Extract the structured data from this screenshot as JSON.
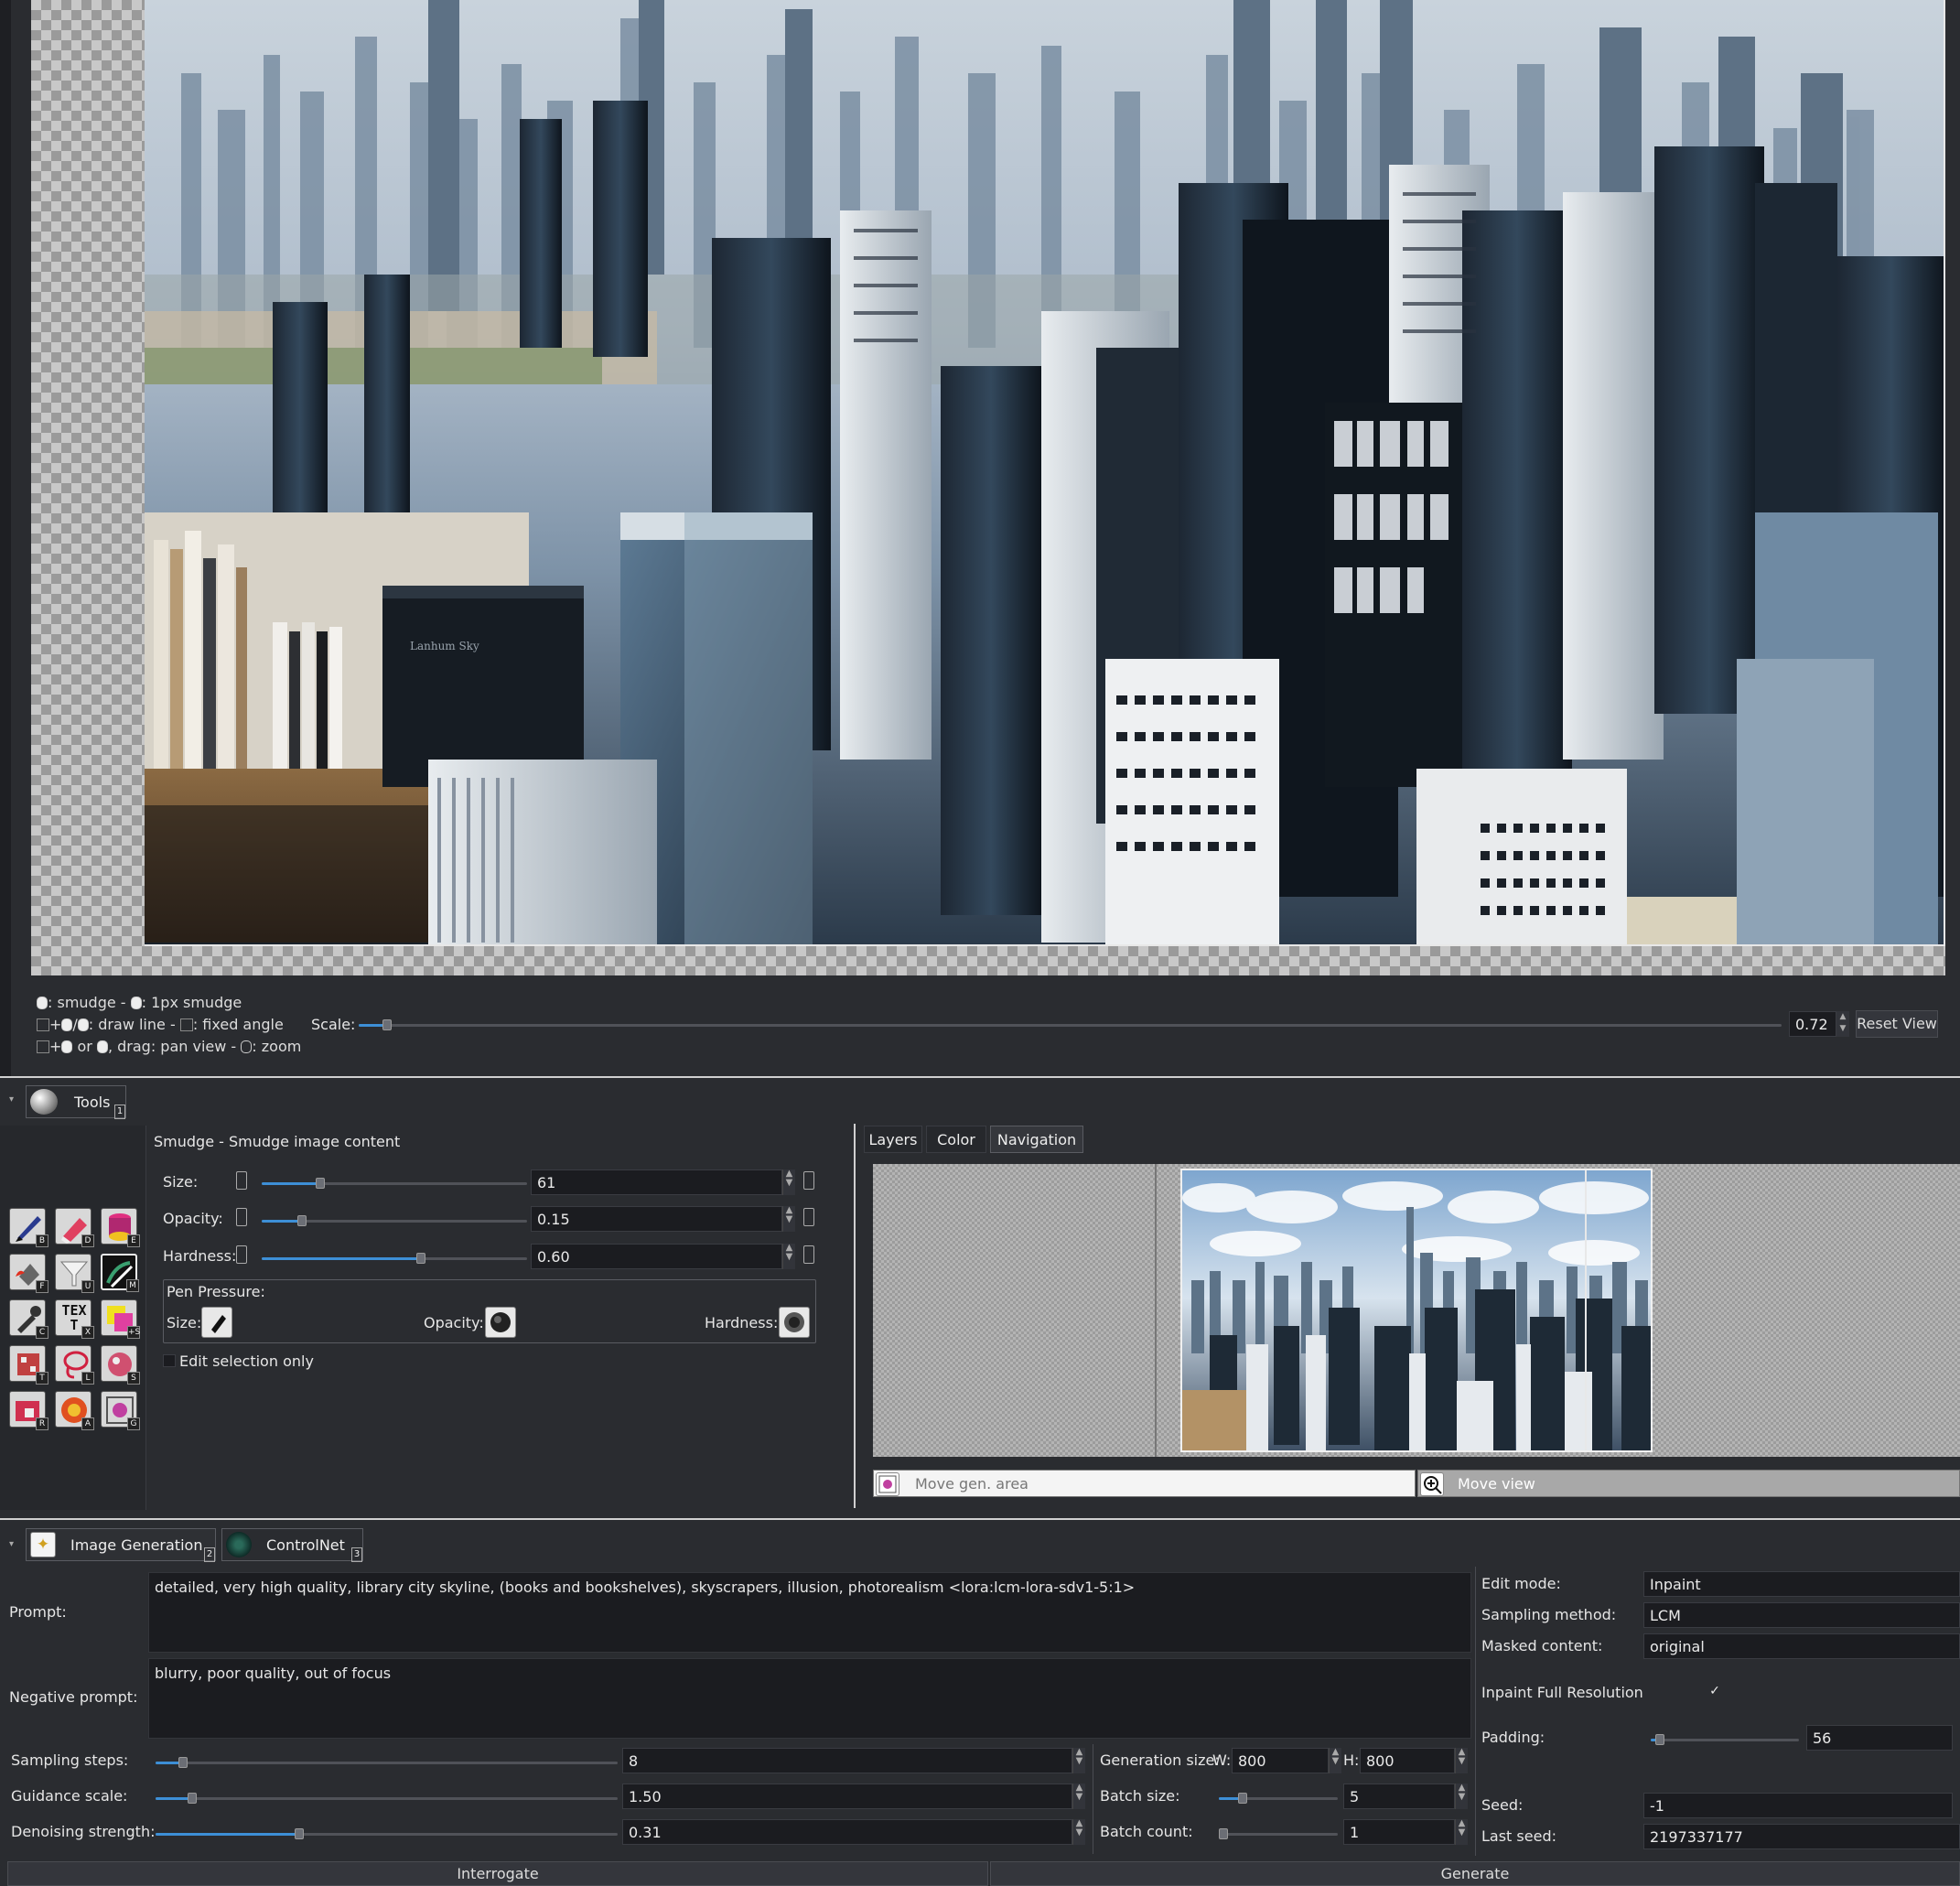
{
  "canvas": {
    "hints": {
      "line1": ": smudge - ",
      "line1b": ": 1px smudge",
      "line2": ": draw line - ",
      "line2b": ": fixed angle",
      "line3": " or ",
      "line3b": ", drag: pan view - ",
      "line3c": ": zoom"
    },
    "scale_label": "Scale:",
    "scale_value": "0.72",
    "scale_fraction": 0.02,
    "reset_view_label": "Reset View",
    "book_title": "Lanhum Sky"
  },
  "tools_panel": {
    "tab_label": "Tools",
    "tab_key": "1",
    "tool_title": "Smudge - Smudge image content",
    "size_label": "Size:",
    "size_value": "61",
    "size_fraction": 0.22,
    "opacity_label": "Opacity:",
    "opacity_value": "0.15",
    "opacity_fraction": 0.15,
    "hardness_label": "Hardness:",
    "hardness_value": "0.60",
    "hardness_fraction": 0.6,
    "pen_pressure_label": "Pen Pressure:",
    "pp_size_label": "Size:",
    "pp_opacity_label": "Opacity:",
    "pp_hardness_label": "Hardness:",
    "edit_selection_label": "Edit selection only",
    "tool_keys": [
      "B",
      "D",
      "E",
      "F",
      "U",
      "M",
      "C",
      "X",
      "+S",
      "T",
      "L",
      "S",
      "R",
      "A",
      "G"
    ],
    "text_tool_glyph": "TEXT"
  },
  "right_panel": {
    "tabs": [
      "Layers",
      "Color",
      "Navigation"
    ],
    "active_tab": "Navigation",
    "move_gen_area_label": "Move gen. area",
    "move_view_label": "Move view"
  },
  "generation": {
    "tab_image_generation": "Image Generation",
    "tab_image_generation_key": "2",
    "tab_controlnet": "ControlNet",
    "tab_controlnet_key": "3",
    "prompt_label": "Prompt:",
    "prompt_value": "detailed, very high quality, library city skyline, (books and bookshelves), skyscrapers, illusion, photorealism <lora:lcm-lora-sdv1-5:1>",
    "negative_prompt_label": "Negative prompt:",
    "negative_prompt_value": "blurry, poor quality, out of focus",
    "sampling_steps_label": "Sampling steps:",
    "sampling_steps_value": "8",
    "sampling_steps_fraction": 0.06,
    "guidance_scale_label": "Guidance scale:",
    "guidance_scale_value": "1.50",
    "guidance_scale_fraction": 0.08,
    "denoising_label": "Denoising strength:",
    "denoising_value": "0.31",
    "denoising_fraction": 0.31,
    "generation_size_label": "Generation size:",
    "w_label": "W:",
    "w_value": "800",
    "h_label": "H:",
    "h_value": "800",
    "batch_size_label": "Batch size:",
    "batch_size_value": "5",
    "batch_size_fraction": 0.2,
    "batch_count_label": "Batch count:",
    "batch_count_value": "1",
    "batch_count_fraction": 0.0,
    "edit_mode_label": "Edit mode:",
    "edit_mode_value": "Inpaint",
    "sampling_method_label": "Sampling method:",
    "sampling_method_value": "LCM",
    "masked_content_label": "Masked content:",
    "masked_content_value": "original",
    "inpaint_full_res_label": "Inpaint Full Resolution",
    "inpaint_full_res_check": "✓",
    "padding_label": "Padding:",
    "padding_value": "56",
    "padding_fraction": 0.06,
    "seed_label": "Seed:",
    "seed_value": "-1",
    "last_seed_label": "Last seed:",
    "last_seed_value": "2197337177",
    "interrogate_label": "Interrogate",
    "generate_label": "Generate"
  }
}
